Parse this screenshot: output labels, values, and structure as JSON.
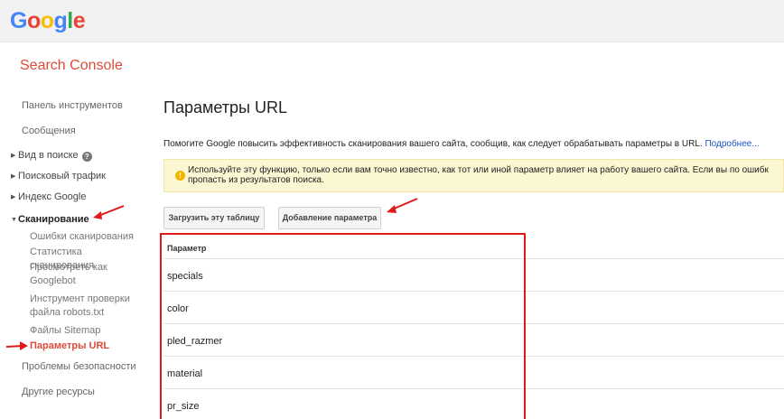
{
  "header": {
    "logo_letters": [
      "G",
      "o",
      "o",
      "g",
      "l",
      "e"
    ],
    "product": "Search Console"
  },
  "sidebar": {
    "dashboard": "Панель инструментов",
    "messages": "Сообщения",
    "search_appearance": "Вид в поиске",
    "search_traffic": "Поисковый трафик",
    "google_index": "Индекс Google",
    "crawl": "Сканирование",
    "crawl_items": [
      "Ошибки сканирования",
      "Статистика сканирования",
      "Просмотреть как Googlebot",
      "Инструмент проверки файла robots.txt",
      "Файлы Sitemap",
      "Параметры URL"
    ],
    "security": "Проблемы безопасности",
    "other": "Другие ресурсы"
  },
  "main": {
    "title": "Параметры URL",
    "description": "Помогите Google повысить эффективность сканирования вашего сайта, сообщив, как следует обрабатывать параметры в URL.",
    "more_link": "Подробнее...",
    "warning_line1": "Используйте эту функцию, только если вам точно известно, как тот или иной параметр влияет на работу вашего сайта. Если вы по ошибк",
    "warning_line2": "пропасть из результатов поиска.",
    "download_button": "Загрузить эту таблицу",
    "add_button": "Добавление параметра",
    "table_header": "Параметр",
    "params": [
      "specials",
      "color",
      "pled_razmer",
      "material",
      "pr_size"
    ]
  },
  "colors": {
    "accent_red": "#dd4b39",
    "annotation_red": "#e01919",
    "link": "#1a55c4"
  },
  "icons": [
    "help-icon",
    "warning-icon",
    "caret-right-icon",
    "caret-down-icon",
    "annotation-arrow"
  ]
}
